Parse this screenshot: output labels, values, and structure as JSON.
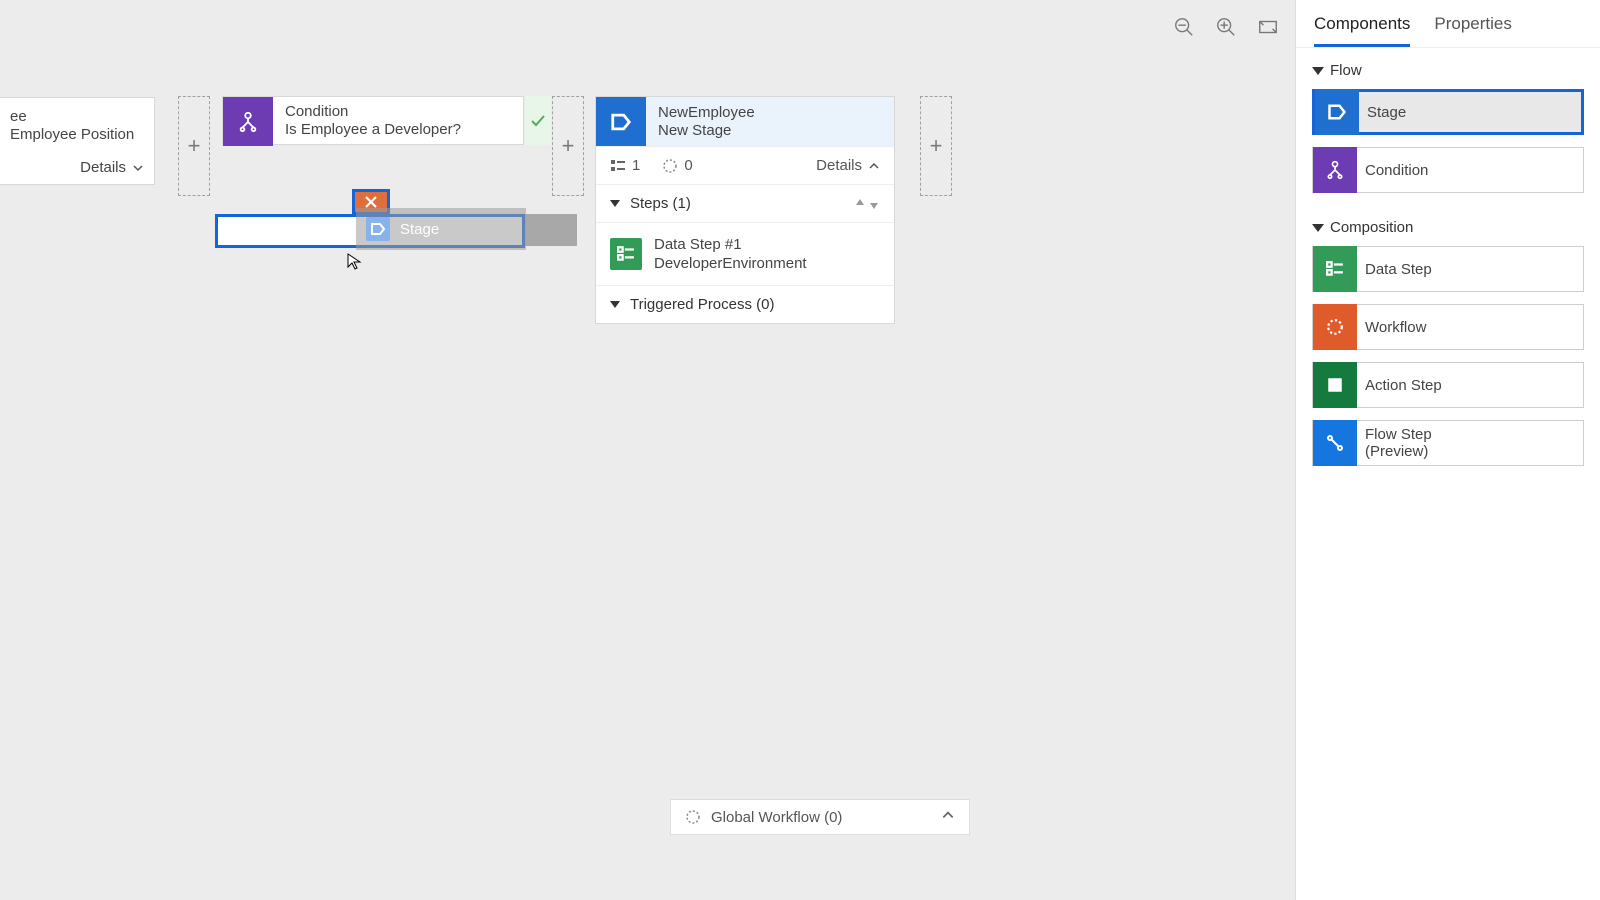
{
  "toolbar": {},
  "canvas": {
    "partial_stage": {
      "line1": "ee",
      "line2": "Employee Position",
      "details": "Details"
    },
    "condition": {
      "label": "Condition",
      "question": "Is Employee a Developer?"
    },
    "drag_ghost": {
      "label": "Stage"
    },
    "stage": {
      "name": "NewEmployee",
      "sub": "New Stage",
      "steps_count": "1",
      "workflow_count": "0",
      "details": "Details",
      "steps_header": "Steps (1)",
      "step1_title": "Data Step #1",
      "step1_sub": "DeveloperEnvironment",
      "triggered": "Triggered Process (0)"
    }
  },
  "global_workflow": {
    "label": "Global Workflow (0)"
  },
  "panel": {
    "tabs": {
      "components": "Components",
      "properties": "Properties"
    },
    "flow_header": "Flow",
    "composition_header": "Composition",
    "items": {
      "stage": "Stage",
      "condition": "Condition",
      "data_step": "Data Step",
      "workflow": "Workflow",
      "action_step": "Action Step",
      "flow_step": "Flow Step\n(Preview)"
    }
  }
}
